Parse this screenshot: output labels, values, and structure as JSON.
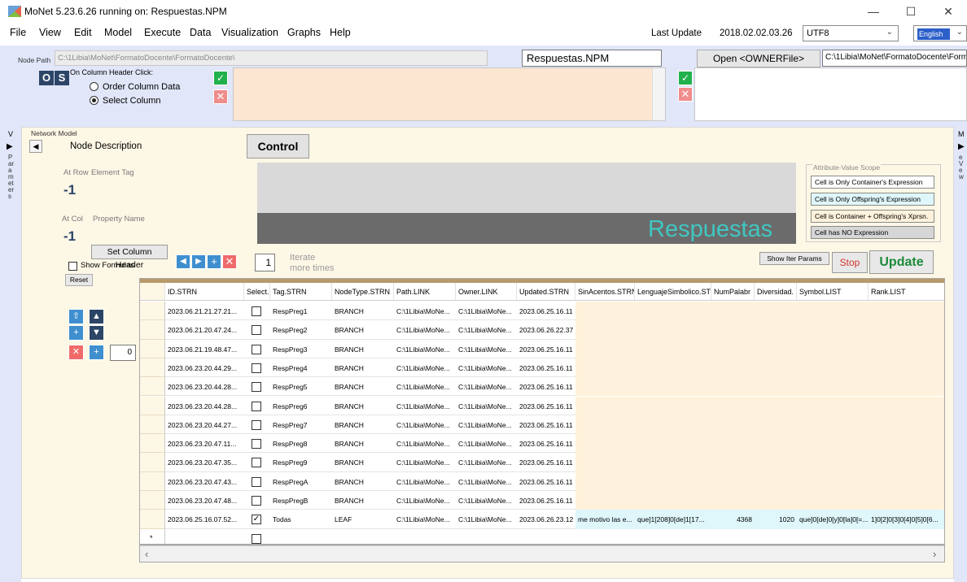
{
  "window": {
    "title": "MoNet 5.23.6.26 running on: Respuestas.NPM",
    "minimize": "—",
    "maximize": "☐",
    "close": "✕"
  },
  "menu": [
    "File",
    "View",
    "Edit",
    "Model",
    "Execute",
    "Data",
    "Visualization",
    "Graphs",
    "Help"
  ],
  "header": {
    "last_update_label": "Last Update",
    "last_update_value": "2018.02.02.03.26",
    "encoding": "UTF8",
    "language": "English"
  },
  "nodepath": {
    "label": "Node Path",
    "value": "C:\\1Libia\\MoNet\\FormatoDocente\\FormatoDocente\\",
    "filename": "Respuestas.NPM",
    "open_owner": "Open <OWNERFile>",
    "owner_path": "C:\\1Libia\\MoNet\\FormatoDocente\\FormatoDocente\\"
  },
  "buttons_os": [
    "O",
    "S"
  ],
  "column_header_click": {
    "label": "On Column Header Click:",
    "options": [
      "Order Column Data",
      "Select Column"
    ],
    "selected": 1
  },
  "sidestrip_left": {
    "top_letter": "V",
    "letters": [
      "P",
      "ar",
      "a",
      "m",
      "et",
      "er",
      "s"
    ]
  },
  "sidestrip_right": {
    "top_letter": "M",
    "letters": [
      "e",
      "V",
      "e",
      "w"
    ]
  },
  "network_model": {
    "label": "Network Model",
    "node_description": "Node Description",
    "control": "Control",
    "at_row_label": "At Row",
    "element_tag_label": "Element Tag",
    "row_value": "-1",
    "at_col_label": "At Col",
    "property_name_label": "Property Name",
    "col_value": "-1",
    "node_name_display": "Respuestas"
  },
  "scope": {
    "label": "Attribute-Value Scope",
    "options": [
      {
        "text": "Cell is Only Container's Expression",
        "color": "#ffffff"
      },
      {
        "text": "Cell is Only Offspring's Expression",
        "color": "#dff6fb"
      },
      {
        "text": "Cell is Container + Offspring's Xprsn.",
        "color": "#fff2dc"
      },
      {
        "text": "Cell has NO Expression",
        "color": "#d6d6d6"
      }
    ]
  },
  "controls": {
    "set_column_header": "Set Column Header",
    "show_formulas": "Show Formulas",
    "reset": "Reset",
    "iterate_count": "1",
    "iterate_label": "Iterate",
    "more_times_label": "more times",
    "show_iter_params": "Show Iter Params",
    "stop": "Stop",
    "update": "Update",
    "row_count": "0"
  },
  "grid": {
    "columns": [
      "ID.STRN",
      "Select.",
      "Tag.STRN",
      "NodeType.STRN",
      "Path.LINK",
      "Owner.LINK",
      "Updated.STRN",
      "SinAcentos.STRN",
      "LenguajeSimbolico.ST",
      "NumPalabr",
      "Diversidad.",
      "Symbol.LIST",
      "Rank.LIST"
    ],
    "rows": [
      {
        "id": "2023.06.21.21.27.21...",
        "checked": false,
        "tag": "RespPreg1",
        "type": "BRANCH",
        "path": "C:\\1Libia\\MoNe...",
        "owner": "C:\\1Libia\\MoNe...",
        "updated": "2023.06.25.16.11",
        "sin": "",
        "leng": "",
        "num": "",
        "div": "",
        "sym": "",
        "rank": ""
      },
      {
        "id": "2023.06.21.20.47.24...",
        "checked": false,
        "tag": "RespPreg2",
        "type": "BRANCH",
        "path": "C:\\1Libia\\MoNe...",
        "owner": "C:\\1Libia\\MoNe...",
        "updated": "2023.06.26.22.37",
        "sin": "",
        "leng": "",
        "num": "",
        "div": "",
        "sym": "",
        "rank": ""
      },
      {
        "id": "2023.06.21.19.48.47...",
        "checked": false,
        "tag": "RespPreg3",
        "type": "BRANCH",
        "path": "C:\\1Libia\\MoNe...",
        "owner": "C:\\1Libia\\MoNe...",
        "updated": "2023.06.25.16.11",
        "sin": "",
        "leng": "",
        "num": "",
        "div": "",
        "sym": "",
        "rank": ""
      },
      {
        "id": "2023.06.23.20.44.29...",
        "checked": false,
        "tag": "RespPreg4",
        "type": "BRANCH",
        "path": "C:\\1Libia\\MoNe...",
        "owner": "C:\\1Libia\\MoNe...",
        "updated": "2023.06.25.16.11",
        "sin": "",
        "leng": "",
        "num": "",
        "div": "",
        "sym": "",
        "rank": ""
      },
      {
        "id": "2023.06.23.20.44.28...",
        "checked": false,
        "tag": "RespPreg5",
        "type": "BRANCH",
        "path": "C:\\1Libia\\MoNe...",
        "owner": "C:\\1Libia\\MoNe...",
        "updated": "2023.06.25.16.11",
        "sin": "",
        "leng": "",
        "num": "",
        "div": "",
        "sym": "",
        "rank": ""
      },
      {
        "id": "2023.06.23.20.44.28...",
        "checked": false,
        "tag": "RespPreg6",
        "type": "BRANCH",
        "path": "C:\\1Libia\\MoNe...",
        "owner": "C:\\1Libia\\MoNe...",
        "updated": "2023.06.25.16.11",
        "sin": "",
        "leng": "",
        "num": "",
        "div": "",
        "sym": "",
        "rank": ""
      },
      {
        "id": "2023.06.23.20.44.27...",
        "checked": false,
        "tag": "RespPreg7",
        "type": "BRANCH",
        "path": "C:\\1Libia\\MoNe...",
        "owner": "C:\\1Libia\\MoNe...",
        "updated": "2023.06.25.16.11",
        "sin": "",
        "leng": "",
        "num": "",
        "div": "",
        "sym": "",
        "rank": ""
      },
      {
        "id": "2023.06.23.20.47.11...",
        "checked": false,
        "tag": "RespPreg8",
        "type": "BRANCH",
        "path": "C:\\1Libia\\MoNe...",
        "owner": "C:\\1Libia\\MoNe...",
        "updated": "2023.06.25.16.11",
        "sin": "",
        "leng": "",
        "num": "",
        "div": "",
        "sym": "",
        "rank": ""
      },
      {
        "id": "2023.06.23.20.47.35...",
        "checked": false,
        "tag": "RespPreg9",
        "type": "BRANCH",
        "path": "C:\\1Libia\\MoNe...",
        "owner": "C:\\1Libia\\MoNe...",
        "updated": "2023.06.25.16.11",
        "sin": "",
        "leng": "",
        "num": "",
        "div": "",
        "sym": "",
        "rank": ""
      },
      {
        "id": "2023.06.23.20.47.43...",
        "checked": false,
        "tag": "RespPregA",
        "type": "BRANCH",
        "path": "C:\\1Libia\\MoNe...",
        "owner": "C:\\1Libia\\MoNe...",
        "updated": "2023.06.25.16.11",
        "sin": "",
        "leng": "",
        "num": "",
        "div": "",
        "sym": "",
        "rank": ""
      },
      {
        "id": "2023.06.23.20.47.48...",
        "checked": false,
        "tag": "RespPregB",
        "type": "BRANCH",
        "path": "C:\\1Libia\\MoNe...",
        "owner": "C:\\1Libia\\MoNe...",
        "updated": "2023.06.25.16.11",
        "sin": "",
        "leng": "",
        "num": "",
        "div": "",
        "sym": "",
        "rank": ""
      },
      {
        "id": "2023.06.25.16.07.52...",
        "checked": true,
        "tag": "Todas",
        "type": "LEAF",
        "path": "C:\\1Libia\\MoNe...",
        "owner": "C:\\1Libia\\MoNe...",
        "updated": "2023.06.26.23.12",
        "sin": "me motivo las e...",
        "leng": "que]1[208]0[de]1[17...",
        "num": "4368",
        "div": "1020",
        "sym": "que]0[de]0[y]0[la]0[=...",
        "rank": "1]0[2]0[3]0[4]0[5]0[6..."
      }
    ],
    "new_row_marker": "*",
    "scroll_left": "‹",
    "scroll_right": "›"
  },
  "colors": {
    "panel_blue": "#e1e6f9",
    "panel_cream": "#fdf7e6",
    "ok_green": "#21b14c",
    "cancel_red": "#f08c8c",
    "accent_cyan": "#40c7c2",
    "nav_blue": "#3f8fcf"
  }
}
